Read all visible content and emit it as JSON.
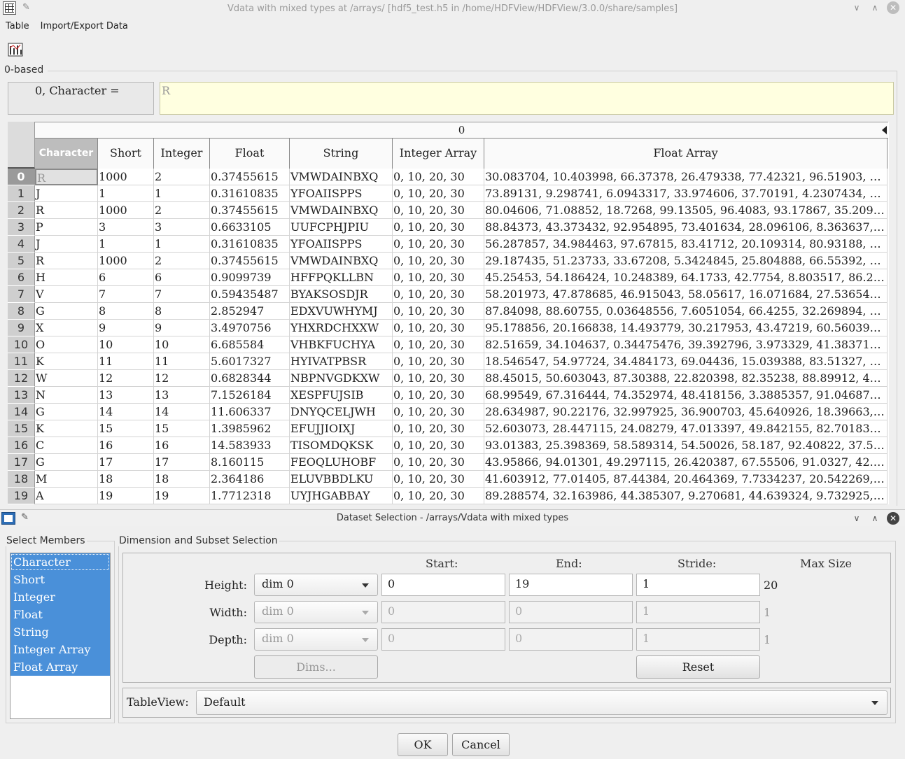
{
  "window": {
    "title": "Vdata with mixed types at /arrays/  [hdf5_test.h5  in  /home/HDFView/HDFView/3.0.0/share/samples]",
    "icon": "spreadsheet-icon"
  },
  "menu": {
    "table": "Table",
    "import_export": "Import/Export Data"
  },
  "toolbar": {
    "chart_icon": "chart-icon"
  },
  "index_mode": "0-based",
  "cell_editor": {
    "label": "0, Character =",
    "value": "R"
  },
  "table": {
    "group_header": "0",
    "columns": [
      "Character",
      "Short",
      "Integer",
      "Float",
      "String",
      "Integer Array",
      "Float Array"
    ],
    "rows": [
      [
        "0",
        "R",
        "1000",
        "2",
        "0.37455615",
        "VMWDAINBXQ",
        "0, 10, 20, 30",
        "30.083704, 10.403998, 66.37378, 26.479338, 77.42321, 96.51903, 8..."
      ],
      [
        "1",
        "J",
        "1",
        "1",
        "0.31610835",
        "YFOAIISPPS",
        "0, 10, 20, 30",
        "73.89131, 9.298741, 6.0943317, 33.974606, 37.70191, 4.2307434, 9..."
      ],
      [
        "2",
        "R",
        "1000",
        "2",
        "0.37455615",
        "VMWDAINBXQ",
        "0, 10, 20, 30",
        "80.04606, 71.08852, 18.7268, 99.13505, 96.4083, 93.17867, 35.2093..."
      ],
      [
        "3",
        "P",
        "3",
        "3",
        "0.6633105",
        "UUFCPHJPIU",
        "0, 10, 20, 30",
        "88.84373, 43.373432, 92.954895, 73.401634, 28.096106, 8.363637, ..."
      ],
      [
        "4",
        "J",
        "1",
        "1",
        "0.31610835",
        "YFOAIISPPS",
        "0, 10, 20, 30",
        "56.287857, 34.984463, 97.67815, 83.41712, 20.109314, 80.93188, 6..."
      ],
      [
        "5",
        "R",
        "1000",
        "2",
        "0.37455615",
        "VMWDAINBXQ",
        "0, 10, 20, 30",
        "29.187435, 51.23733, 33.67208, 5.3424845, 25.804888, 66.55392, 7..."
      ],
      [
        "6",
        "H",
        "6",
        "6",
        "0.9099739",
        "HFFPQKLLBN",
        "0, 10, 20, 30",
        "45.25453, 54.186424, 10.248389, 64.1733, 42.7754, 8.803517, 86.23..."
      ],
      [
        "7",
        "V",
        "7",
        "7",
        "0.59435487",
        "BYAKSOSDJR",
        "0, 10, 20, 30",
        "58.201973, 47.878685, 46.915043, 58.05617, 16.071684, 27.536545,..."
      ],
      [
        "8",
        "G",
        "8",
        "8",
        "2.852947",
        "EDXVUWHYMJ",
        "0, 10, 20, 30",
        "87.84098, 88.60755, 0.03648556, 7.6051054, 66.4255, 32.269894, 3..."
      ],
      [
        "9",
        "X",
        "9",
        "9",
        "3.4970756",
        "YHXRDCHXXW",
        "0, 10, 20, 30",
        "95.178856, 20.166838, 14.493779, 30.217953, 43.47219, 60.560394,..."
      ],
      [
        "10",
        "O",
        "10",
        "10",
        "6.685584",
        "VHBKFUCHYA",
        "0, 10, 20, 30",
        "82.51659, 34.104637, 0.34475476, 39.392796, 3.973329, 41.383717,..."
      ],
      [
        "11",
        "K",
        "11",
        "11",
        "5.6017327",
        "HYIVATPBSR",
        "0, 10, 20, 30",
        "18.546547, 54.97724, 34.484173, 69.04436, 15.039388, 83.51327, 7..."
      ],
      [
        "12",
        "W",
        "12",
        "12",
        "0.6828344",
        "NBPNVGDKXW",
        "0, 10, 20, 30",
        "88.45015, 50.603043, 87.30388, 22.820398, 82.35238, 88.89912, 46...."
      ],
      [
        "13",
        "N",
        "13",
        "13",
        "7.1526184",
        "XESPFUJSIB",
        "0, 10, 20, 30",
        "68.99549, 67.316444, 74.352974, 48.418156, 3.3885357, 91.046875,..."
      ],
      [
        "14",
        "G",
        "14",
        "14",
        "11.606337",
        "DNYQCELJWH",
        "0, 10, 20, 30",
        "28.634987, 90.22176, 32.997925, 36.900703, 45.640926, 18.39663, ..."
      ],
      [
        "15",
        "K",
        "15",
        "15",
        "1.3985962",
        "EFUJJIOIXJ",
        "0, 10, 20, 30",
        "52.603073, 28.447115, 24.08279, 47.013397, 49.842155, 82.701836,..."
      ],
      [
        "16",
        "C",
        "16",
        "16",
        "14.583933",
        "TISOMDQKSK",
        "0, 10, 20, 30",
        "93.01383, 25.398369, 58.589314, 54.50026, 58.187, 92.40822, 37.58..."
      ],
      [
        "17",
        "G",
        "17",
        "17",
        "8.160115",
        "FEOQLUHOBF",
        "0, 10, 20, 30",
        "43.95866, 94.01301, 49.297115, 26.420387, 67.55506, 91.0327, 42.6..."
      ],
      [
        "18",
        "M",
        "18",
        "18",
        "2.364186",
        "ELUVBBDLKU",
        "0, 10, 20, 30",
        "41.603912, 77.01405, 87.44384, 20.464369, 7.7334237, 20.542269, ..."
      ],
      [
        "19",
        "A",
        "19",
        "19",
        "1.7712318",
        "UYJHGABBAY",
        "0, 10, 20, 30",
        "89.288574, 32.163986, 44.385307, 9.270681, 44.639324, 9.732925, ..."
      ]
    ]
  },
  "dialog": {
    "title": "Dataset Selection - /arrays/Vdata with mixed types",
    "members_title": "Select Members",
    "members": [
      "Character",
      "Short",
      "Integer",
      "Float",
      "String",
      "Integer Array",
      "Float Array"
    ],
    "subset_title": "Dimension and Subset Selection",
    "headers": {
      "start": "Start:",
      "end": "End:",
      "stride": "Stride:",
      "max": "Max Size"
    },
    "height": {
      "label": "Height:",
      "dim": "dim 0",
      "start": "0",
      "end": "19",
      "stride": "1",
      "max": "20"
    },
    "width": {
      "label": "Width:",
      "dim": "dim 0",
      "start": "0",
      "end": "0",
      "stride": "1",
      "max": "1"
    },
    "depth": {
      "label": "Depth:",
      "dim": "dim 0",
      "start": "0",
      "end": "0",
      "stride": "1",
      "max": "1"
    },
    "dims_button": "Dims...",
    "reset_button": "Reset",
    "tableview_label": "TableView:",
    "tableview_value": "Default",
    "ok": "OK",
    "cancel": "Cancel"
  }
}
